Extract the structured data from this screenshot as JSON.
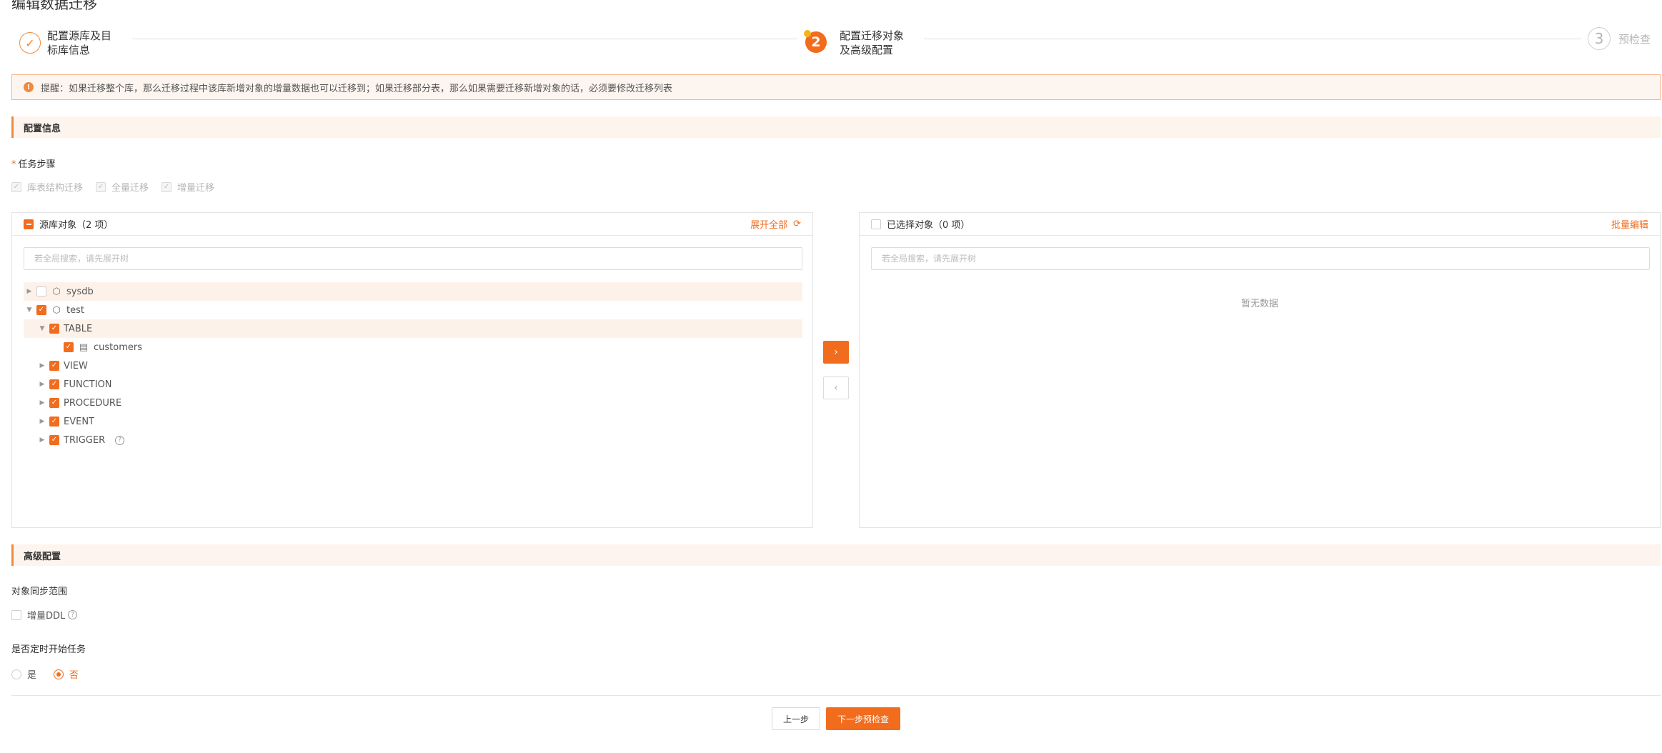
{
  "page": {
    "title": "编辑数据迁移"
  },
  "stepper": {
    "steps": [
      {
        "label": "配置源库及目\n标库信息",
        "status": "done",
        "icon": "check-icon"
      },
      {
        "label": "配置迁移对象\n及高级配置",
        "status": "active",
        "number": "2"
      },
      {
        "label": "预检查",
        "status": "pending",
        "number": "3"
      }
    ]
  },
  "alert": {
    "icon": "warning-icon",
    "text": "提醒：如果迁移整个库，那么迁移过程中该库新增对象的增量数据也可以迁移到；如果迁移部分表，那么如果需要迁移新增对象的话，必须要修改迁移列表"
  },
  "config_section": {
    "title": "配置信息",
    "task_steps_label": "任务步骤",
    "task_steps": [
      {
        "label": "库表结构迁移",
        "checked": true,
        "disabled": true
      },
      {
        "label": "全量迁移",
        "checked": true,
        "disabled": true
      },
      {
        "label": "增量迁移",
        "checked": true,
        "disabled": true
      }
    ]
  },
  "source_panel": {
    "title": "源库对象（2 项）",
    "expand_all": "展开全部",
    "search_placeholder": "若全局搜索，请先展开树",
    "tree": [
      {
        "label": "sysdb",
        "level": 0,
        "expanded": false,
        "checked": false,
        "icon": "database-icon",
        "highlight": true
      },
      {
        "label": "test",
        "level": 0,
        "expanded": true,
        "checked": true,
        "icon": "database-icon",
        "highlight": false
      },
      {
        "label": "TABLE",
        "level": 1,
        "expanded": true,
        "checked": true,
        "icon": "",
        "highlight": true
      },
      {
        "label": "customers",
        "level": 2,
        "expanded": null,
        "checked": true,
        "icon": "table-icon",
        "highlight": false
      },
      {
        "label": "VIEW",
        "level": 1,
        "expanded": false,
        "checked": true,
        "icon": "",
        "highlight": false
      },
      {
        "label": "FUNCTION",
        "level": 1,
        "expanded": false,
        "checked": true,
        "icon": "",
        "highlight": false
      },
      {
        "label": "PROCEDURE",
        "level": 1,
        "expanded": false,
        "checked": true,
        "icon": "",
        "highlight": false
      },
      {
        "label": "EVENT",
        "level": 1,
        "expanded": false,
        "checked": true,
        "icon": "",
        "highlight": false
      },
      {
        "label": "TRIGGER",
        "level": 1,
        "expanded": false,
        "checked": true,
        "icon": "",
        "highlight": false,
        "help": true
      }
    ]
  },
  "target_panel": {
    "title": "已选择对象（0 项）",
    "batch_edit": "批量编辑",
    "search_placeholder": "若全局搜索，请先展开树",
    "empty_text": "暂无数据"
  },
  "transfer": {
    "to_right_icon": "chevron-right-icon",
    "to_left_icon": "chevron-left-icon"
  },
  "advanced_section": {
    "title": "高级配置",
    "sync_scope_label": "对象同步范围",
    "ddl_label": "增量DDL",
    "schedule_label": "是否定时开始任务",
    "options": [
      {
        "label": "是",
        "selected": false
      },
      {
        "label": "否",
        "selected": true
      }
    ]
  },
  "footer": {
    "prev_label": "上一步",
    "next_label": "下一步预检查"
  },
  "colors": {
    "accent": "#f26c1d",
    "accent_light": "#fdf4ee",
    "border": "#e4e4e4"
  }
}
